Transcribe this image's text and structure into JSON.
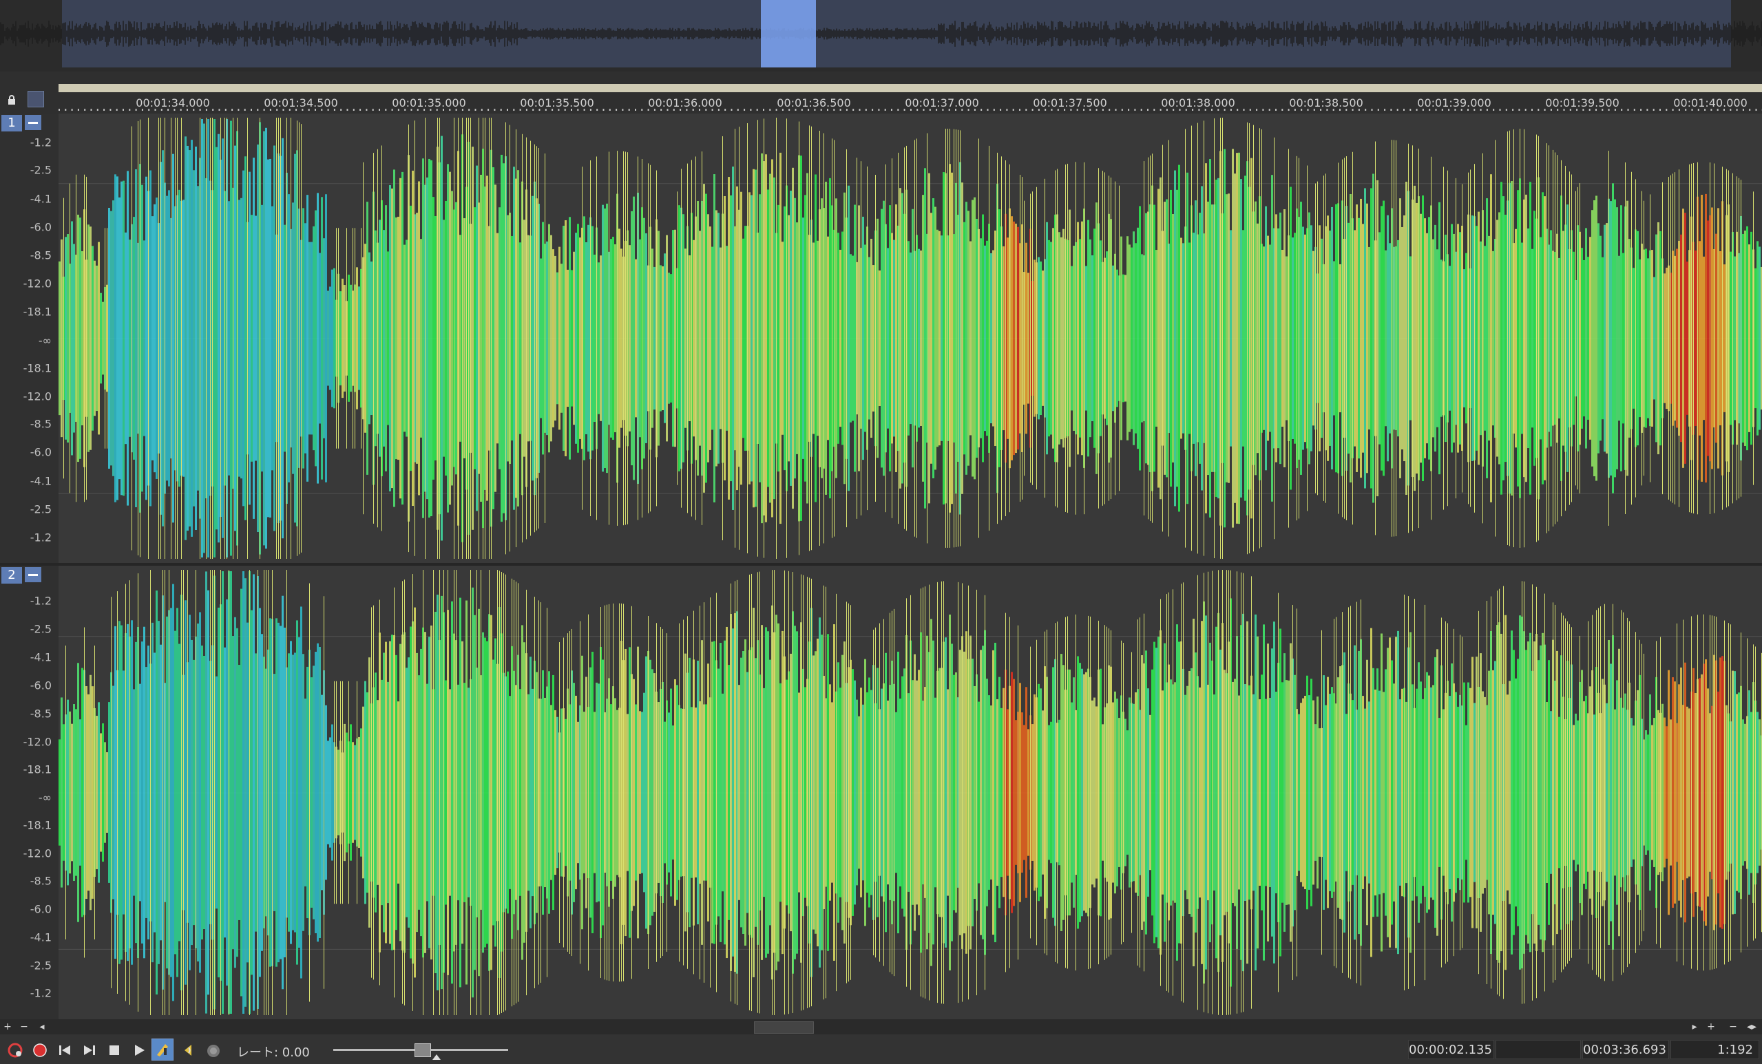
{
  "overview": {
    "selection_hint": "overview-selection"
  },
  "ruler": {
    "ticks": [
      "00:01:34.000",
      "00:01:34.500",
      "00:01:35.000",
      "00:01:35.500",
      "00:01:36.000",
      "00:01:36.500",
      "00:01:37.000",
      "00:01:37.500",
      "00:01:38.000",
      "00:01:38.500",
      "00:01:39.000",
      "00:01:39.500",
      "00:01:40.000"
    ]
  },
  "channels": [
    {
      "label": "1"
    },
    {
      "label": "2"
    }
  ],
  "db_scale": [
    "-1.2",
    "-2.5",
    "-4.1",
    "-6.0",
    "-8.5",
    "-12.0",
    "-18.1",
    "-∞",
    "-18.1",
    "-12.0",
    "-8.5",
    "-6.0",
    "-4.1",
    "-2.5",
    "-1.2"
  ],
  "scrollbar": {
    "left_buttons": [
      "+",
      "−",
      "◂"
    ],
    "right_buttons": [
      "▸",
      "+",
      "−",
      "◂▸"
    ]
  },
  "transport": {
    "rate_label": "レート: 0.00",
    "icons": [
      "record-arm-icon",
      "record-icon",
      "skip-start-icon",
      "skip-end-icon",
      "stop-icon",
      "play-icon",
      "scrub-icon",
      "loop-icon",
      "metronome-icon"
    ]
  },
  "status": {
    "cursor_time": "00:00:02.135",
    "selection_length": "",
    "total_length": "00:03:36.693",
    "zoom_ratio": "1:192"
  },
  "colors": {
    "wave_low": "#2fb8c8",
    "wave_mid": "#3ee86a",
    "wave_hot": "#e0d050",
    "wave_peak": "#e03020",
    "overview_selection": "#7ea5f5",
    "background": "#393939"
  }
}
